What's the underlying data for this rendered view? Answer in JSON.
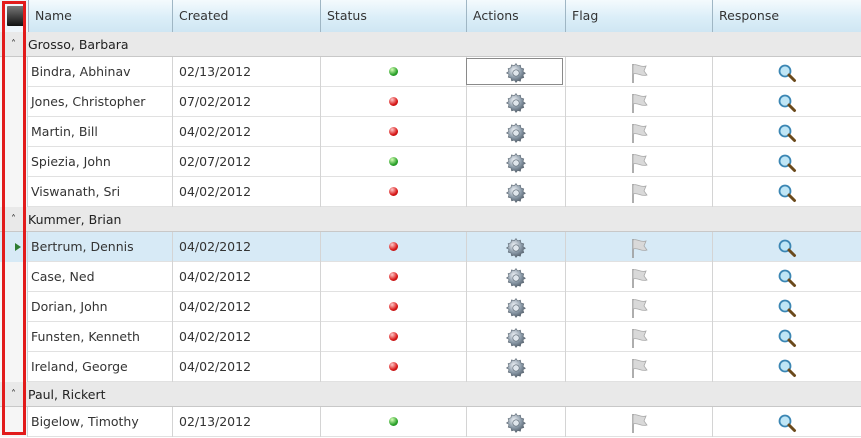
{
  "columns": {
    "name": "Name",
    "created": "Created",
    "status": "Status",
    "actions": "Actions",
    "flag": "Flag",
    "response": "Response"
  },
  "colors": {
    "status_green": "#2ca32c",
    "status_red": "#d81818",
    "selection": "#d7eaf6",
    "highlight_border": "#e21b1b"
  },
  "groups": [
    {
      "label": "Grosso, Barbara",
      "rows": [
        {
          "name": "Bindra, Abhinav",
          "created": "02/13/2012",
          "status": "green"
        },
        {
          "name": "Jones, Christopher",
          "created": "07/02/2012",
          "status": "red"
        },
        {
          "name": "Martin, Bill",
          "created": "04/02/2012",
          "status": "red"
        },
        {
          "name": "Spiezia, John",
          "created": "02/07/2012",
          "status": "green"
        },
        {
          "name": "Viswanath, Sri",
          "created": "04/02/2012",
          "status": "red"
        }
      ]
    },
    {
      "label": "Kummer, Brian",
      "rows": [
        {
          "name": "Bertrum, Dennis",
          "created": "04/02/2012",
          "status": "red",
          "selected": true
        },
        {
          "name": "Case, Ned",
          "created": "04/02/2012",
          "status": "red"
        },
        {
          "name": "Dorian, John",
          "created": "04/02/2012",
          "status": "red"
        },
        {
          "name": "Funsten, Kenneth",
          "created": "04/02/2012",
          "status": "red"
        },
        {
          "name": "Ireland, George",
          "created": "04/02/2012",
          "status": "red"
        }
      ]
    },
    {
      "label": "Paul, Rickert",
      "rows": [
        {
          "name": "Bigelow, Timothy",
          "created": "02/13/2012",
          "status": "green"
        }
      ]
    }
  ],
  "icons": {
    "actions": "gear-icon",
    "flag": "flag-icon",
    "response": "magnifier-icon",
    "group_toggle": "chevron-up-icon",
    "current_row": "play-arrow-icon"
  }
}
